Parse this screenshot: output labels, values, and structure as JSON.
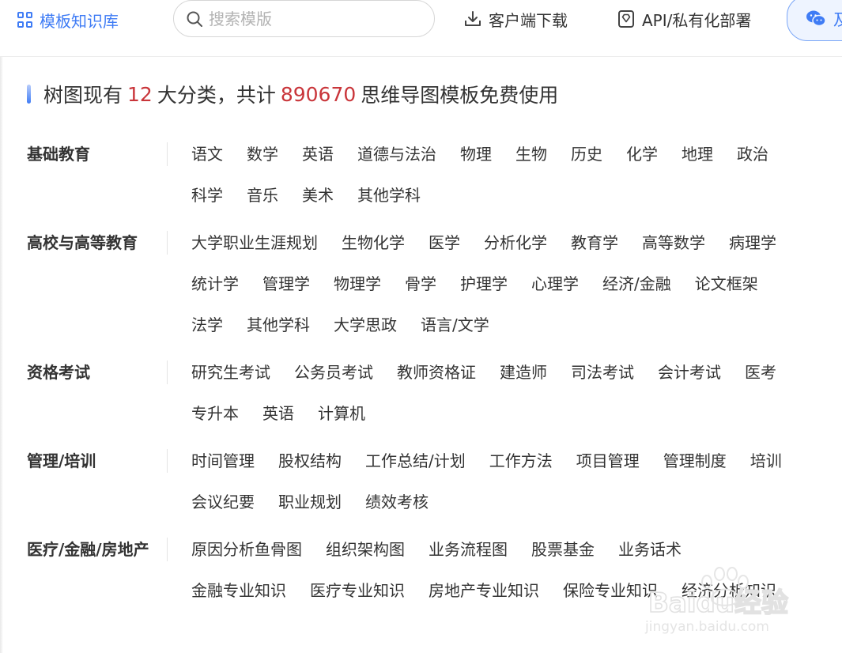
{
  "nav": {
    "library_label": "模板知识库",
    "search_placeholder": "搜索模版",
    "download_label": "客户端下载",
    "api_label": "API/私有化部署",
    "wechat_label": "及"
  },
  "headline": {
    "prefix": "树图现有",
    "category_count": "12",
    "middle": "大分类，共计",
    "template_count": "890670",
    "suffix": "思维导图模板免费使用"
  },
  "categories": [
    {
      "title": "基础教育",
      "items": [
        "语文",
        "数学",
        "英语",
        "道德与法治",
        "物理",
        "生物",
        "历史",
        "化学",
        "地理",
        "政治",
        "科学",
        "音乐",
        "美术",
        "其他学科"
      ]
    },
    {
      "title": "高校与高等教育",
      "items": [
        "大学职业生涯规划",
        "生物化学",
        "医学",
        "分析化学",
        "教育学",
        "高等数学",
        "病理学",
        "统计学",
        "管理学",
        "物理学",
        "骨学",
        "护理学",
        "心理学",
        "经济/金融",
        "论文框架",
        "法学",
        "其他学科",
        "大学思政",
        "语言/文学"
      ]
    },
    {
      "title": "资格考试",
      "items": [
        "研究生考试",
        "公务员考试",
        "教师资格证",
        "建造师",
        "司法考试",
        "会计考试",
        "医考",
        "专升本",
        "英语",
        "计算机"
      ]
    },
    {
      "title": "管理/培训",
      "items": [
        "时间管理",
        "股权结构",
        "工作总结/计划",
        "工作方法",
        "项目管理",
        "管理制度",
        "培训",
        "会议纪要",
        "职业规划",
        "绩效考核"
      ]
    },
    {
      "title": "医疗/金融/房地产",
      "items": [
        "原因分析鱼骨图",
        "组织架构图",
        "业务流程图",
        "股票基金",
        "业务话术",
        "金融专业知识",
        "医疗专业知识",
        "房地产专业知识",
        "保险专业知识",
        "经济分析知识"
      ]
    }
  ],
  "watermark": {
    "brand": "Baidu经验",
    "url": "jingyan.baidu.com"
  },
  "colors": {
    "accent": "#3f7cf5",
    "highlight_number": "#c9353a"
  }
}
